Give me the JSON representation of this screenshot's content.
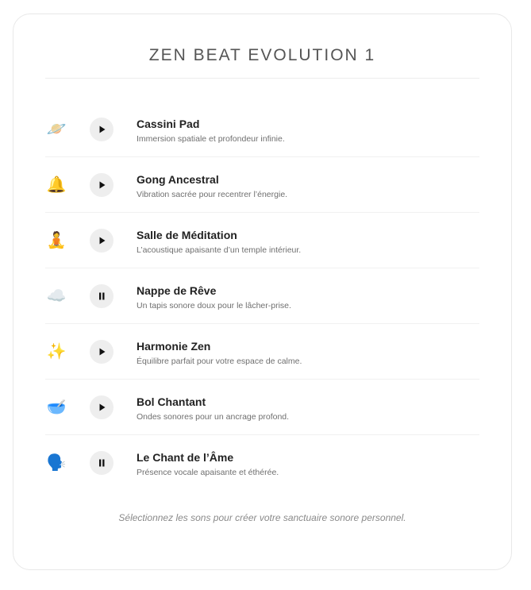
{
  "header": {
    "title": "ZEN BEAT EVOLUTION 1"
  },
  "tracks": [
    {
      "icon": "ringed-planet-icon",
      "emoji": "🪐",
      "name": "Cassini Pad",
      "description": "Immersion spatiale et profondeur infinie.",
      "state": "paused"
    },
    {
      "icon": "bell-icon",
      "emoji": "🔔",
      "name": "Gong Ancestral",
      "description": "Vibration sacrée pour recentrer l’énergie.",
      "state": "paused"
    },
    {
      "icon": "person-meditating-icon",
      "emoji": "🧘",
      "name": "Salle de Méditation",
      "description": "L’acoustique apaisante d’un temple intérieur.",
      "state": "paused"
    },
    {
      "icon": "cloud-icon",
      "emoji": "☁️",
      "name": "Nappe de Rêve",
      "description": "Un tapis sonore doux pour le lâcher-prise.",
      "state": "playing"
    },
    {
      "icon": "sparkles-icon",
      "emoji": "✨",
      "name": "Harmonie Zen",
      "description": "Équilibre parfait pour votre espace de calme.",
      "state": "paused"
    },
    {
      "icon": "bowl-icon",
      "emoji": "🥣",
      "name": "Bol Chantant",
      "description": "Ondes sonores pour un ancrage profond.",
      "state": "paused"
    },
    {
      "icon": "speaking-head-icon",
      "emoji": "🗣️",
      "name": "Le Chant de l’Âme",
      "description": "Présence vocale apaisante et éthérée.",
      "state": "playing"
    }
  ],
  "footer": {
    "note": "Sélectionnez les sons pour créer votre sanctuaire sonore personnel."
  },
  "colors": {
    "button_bg": "#eeeeee",
    "glyph": "#111111",
    "title": "#555555"
  }
}
